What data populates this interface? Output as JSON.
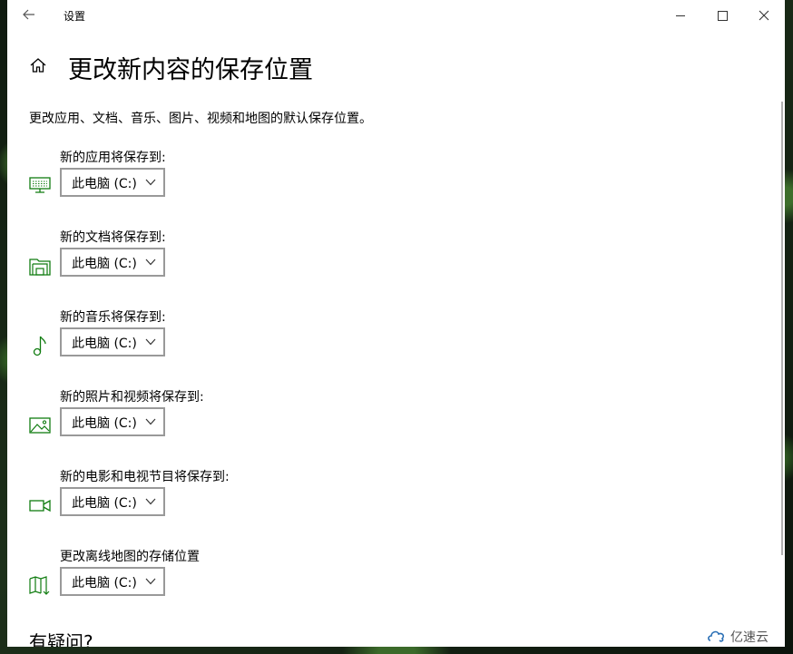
{
  "window": {
    "title": "设置"
  },
  "page": {
    "title": "更改新内容的保存位置",
    "description": "更改应用、文档、音乐、图片、视频和地图的默认保存位置。"
  },
  "settings": [
    {
      "label": "新的应用将保存到:",
      "value": "此电脑 (C:)",
      "icon": "monitor-icon"
    },
    {
      "label": "新的文档将保存到:",
      "value": "此电脑 (C:)",
      "icon": "documents-icon"
    },
    {
      "label": "新的音乐将保存到:",
      "value": "此电脑 (C:)",
      "icon": "music-note-icon"
    },
    {
      "label": "新的照片和视频将保存到:",
      "value": "此电脑 (C:)",
      "icon": "picture-icon"
    },
    {
      "label": "新的电影和电视节目将保存到:",
      "value": "此电脑 (C:)",
      "icon": "video-camera-icon"
    },
    {
      "label": "更改离线地图的存储位置",
      "value": "此电脑 (C:)",
      "icon": "map-icon"
    }
  ],
  "footer": {
    "heading": "有疑问?"
  },
  "watermark": {
    "text": "亿速云"
  },
  "colors": {
    "accent": "#107c10",
    "border": "#999999"
  }
}
